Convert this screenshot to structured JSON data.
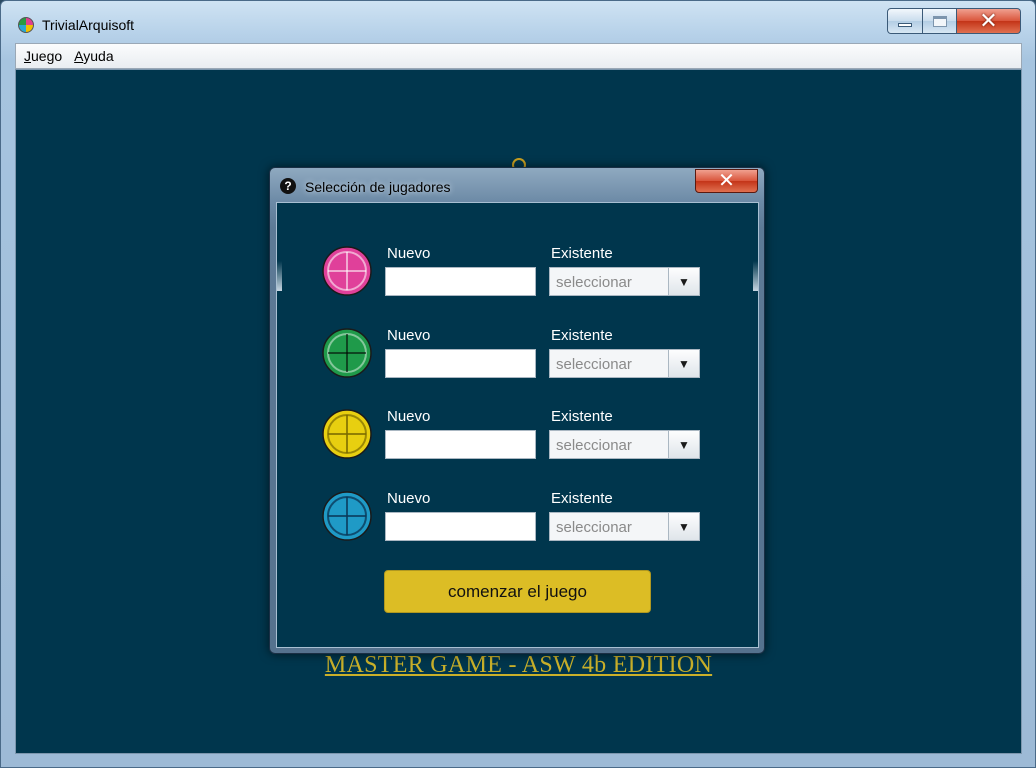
{
  "window": {
    "title": "TrivialArquisoft",
    "close_glyph": "✕"
  },
  "menu": [
    {
      "accel": "J",
      "rest": "uego"
    },
    {
      "accel": "A",
      "rest": "yuda"
    }
  ],
  "background": {
    "title": "MASTER GAME - ASW 4b EDITION"
  },
  "dialog": {
    "title": "Selección de jugadores",
    "help_glyph": "?",
    "close_glyph": "✕",
    "players": [
      {
        "color": "#e0409a",
        "new_label": "Nuevo",
        "existing_label": "Existente",
        "new_value": "",
        "select_value": "seleccionar"
      },
      {
        "color": "#1f9a4a",
        "new_label": "Nuevo",
        "existing_label": "Existente",
        "new_value": "",
        "select_value": "seleccionar"
      },
      {
        "color": "#e8cf10",
        "new_label": "Nuevo",
        "existing_label": "Existente",
        "new_value": "",
        "select_value": "seleccionar"
      },
      {
        "color": "#1f9ac6",
        "new_label": "Nuevo",
        "existing_label": "Existente",
        "new_value": "",
        "select_value": "seleccionar"
      }
    ],
    "start_button": "comenzar el juego",
    "dropdown_glyph": "▼"
  }
}
